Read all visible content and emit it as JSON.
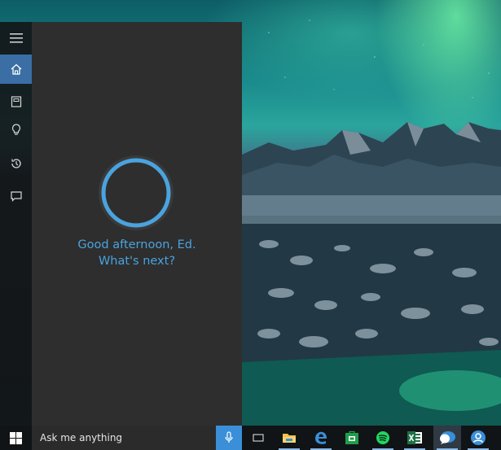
{
  "rail": {
    "items": [
      {
        "name": "menu-icon"
      },
      {
        "name": "home-icon",
        "active": true
      },
      {
        "name": "notebook-icon"
      },
      {
        "name": "lightbulb-icon"
      },
      {
        "name": "history-icon"
      },
      {
        "name": "feedback-icon"
      }
    ]
  },
  "cortana": {
    "greeting_line1": "Good afternoon, Ed.",
    "greeting_line2": "What's next?",
    "accent": "#4aa3df"
  },
  "taskbar": {
    "search_placeholder": "Ask me anything",
    "apps": [
      {
        "name": "task-view-icon"
      },
      {
        "name": "file-explorer-icon",
        "open": true
      },
      {
        "name": "edge-icon",
        "open": true
      },
      {
        "name": "store-icon"
      },
      {
        "name": "spotify-icon",
        "open": true
      },
      {
        "name": "excel-icon",
        "open": true
      },
      {
        "name": "chat-app-icon",
        "open": true
      },
      {
        "name": "cortana-app-icon",
        "open": true
      }
    ]
  },
  "colors": {
    "panel": "#2e2e2e",
    "rail": "#16181a",
    "taskbar": "#101417",
    "active": "#3a6ea5",
    "mic": "#3a8fd8"
  }
}
